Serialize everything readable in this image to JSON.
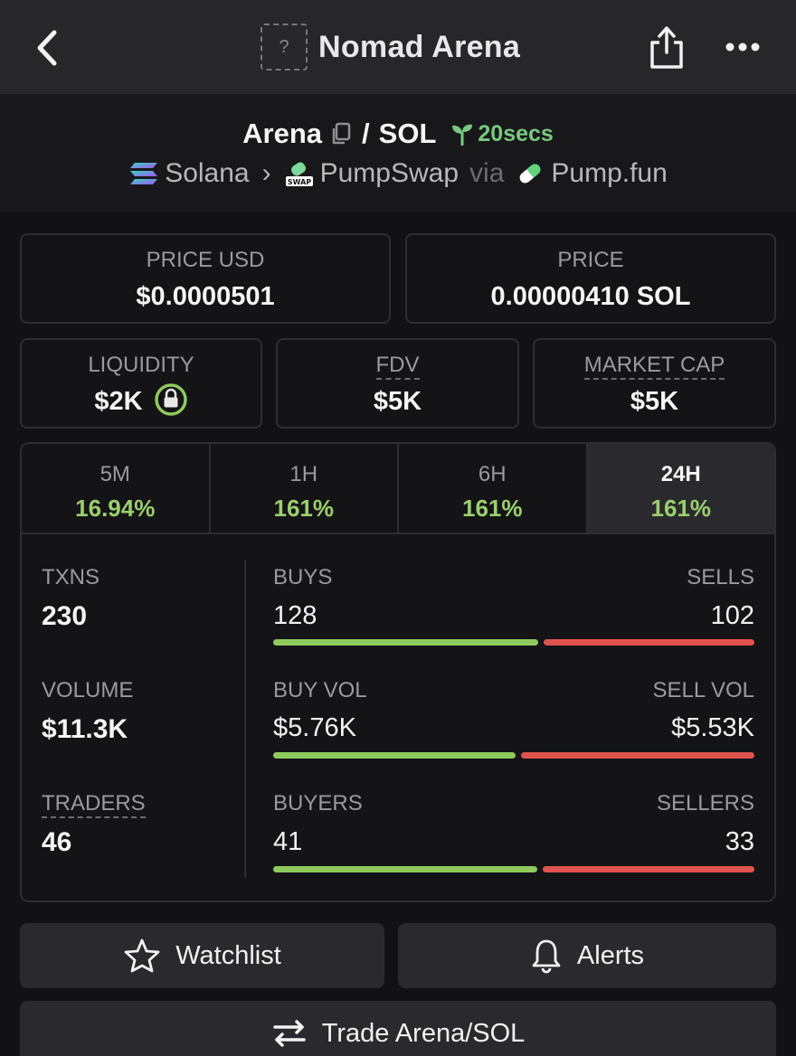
{
  "header": {
    "title": "Nomad Arena",
    "token_placeholder": "?"
  },
  "pair": {
    "base": "Arena",
    "slash": "/",
    "quote": "SOL",
    "age": "20secs",
    "chain": "Solana",
    "dex": "PumpSwap",
    "via": "via",
    "launchpad": "Pump.fun"
  },
  "prices": {
    "usd_label": "PRICE USD",
    "usd_value": "$0.0000501",
    "native_label": "PRICE",
    "native_value": "0.00000410 SOL"
  },
  "metrics": {
    "liquidity_label": "LIQUIDITY",
    "liquidity_value": "$2K",
    "fdv_label": "FDV",
    "fdv_value": "$5K",
    "mcap_label": "MARKET CAP",
    "mcap_value": "$5K"
  },
  "tabs": [
    {
      "label": "5M",
      "value": "16.94%"
    },
    {
      "label": "1H",
      "value": "161%"
    },
    {
      "label": "6H",
      "value": "161%"
    },
    {
      "label": "24H",
      "value": "161%"
    }
  ],
  "active_tab": "24H",
  "stats": {
    "txns_label": "TXNS",
    "txns_value": "230",
    "volume_label": "VOLUME",
    "volume_value": "$11.3K",
    "traders_label": "TRADERS",
    "traders_value": "46",
    "buys_label": "BUYS",
    "buys_value": "128",
    "sells_label": "SELLS",
    "sells_value": "102",
    "buyvol_label": "BUY VOL",
    "buyvol_value": "$5.76K",
    "sellvol_label": "SELL VOL",
    "sellvol_value": "$5.53K",
    "buyers_label": "BUYERS",
    "buyers_value": "41",
    "sellers_label": "SELLERS",
    "sellers_value": "33"
  },
  "ratios": {
    "buys": 0.556,
    "buy_vol": 0.51,
    "buyers": 0.554
  },
  "actions": {
    "watchlist": "Watchlist",
    "alerts": "Alerts",
    "trade": "Trade Arena/SOL"
  },
  "colors": {
    "positive": "#8fca5d",
    "negative": "#e0534f",
    "age": "#79c97f"
  }
}
